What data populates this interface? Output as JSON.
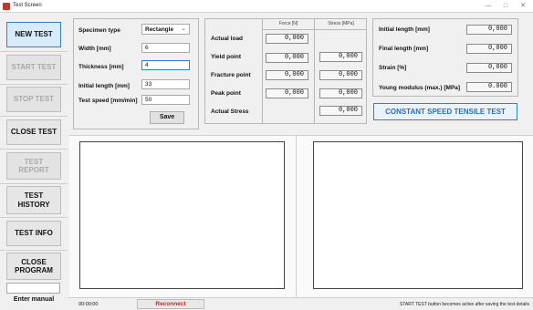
{
  "window": {
    "title": "Test Screen",
    "minimize": "—",
    "maximize": "□",
    "close": "✕"
  },
  "sidebar": {
    "new_test": "NEW TEST",
    "start_test": "START TEST",
    "stop_test": "STOP TEST",
    "close_test": "CLOSE TEST",
    "test_report": "TEST REPORT",
    "test_history": "TEST HISTORY",
    "test_info": "TEST INFO",
    "close_program": "CLOSE PROGRAM",
    "enter_manual": "Enter manual"
  },
  "specimen": {
    "type_label": "Specimen type",
    "type_value": "Rectangle",
    "width_label": "Width [mm]",
    "width_value": "6",
    "thickness_label": "Thickness [mm]",
    "thickness_value": "4",
    "initial_length_label": "Initial length [mm]",
    "initial_length_value": "33",
    "test_speed_label": "Test speed [mm/min]",
    "test_speed_value": "50",
    "save": "Save"
  },
  "measurements": {
    "force_header": "Force [N]",
    "stress_header": "Stress [MPa]",
    "actual_load_label": "Actual load",
    "actual_load": "0,000",
    "yield_point_label": "Yield point",
    "yield_force": "0,000",
    "yield_stress": "0,000",
    "fracture_point_label": "Fracture point",
    "fracture_force": "0,000",
    "fracture_stress": "0,000",
    "peak_point_label": "Peak point",
    "peak_force": "0,000",
    "peak_stress": "0,000",
    "actual_stress_label": "Actual Stress",
    "actual_stress": "0,000"
  },
  "results": {
    "initial_length_label": "Initial length [mm]",
    "initial_length": "0,000",
    "final_length_label": "Final length [mm]",
    "final_length": "0,000",
    "strain_label": "Strain [%]",
    "strain": "0,000",
    "young_label": "Young modulus (max.) [MPa]",
    "young": "0.000",
    "constant_speed": "CONSTANT SPEED TENSILE TEST"
  },
  "status": {
    "time": "00:00:00",
    "reconnect": "Reconnect",
    "message": "START TEST button becomes active after saving the test details"
  }
}
